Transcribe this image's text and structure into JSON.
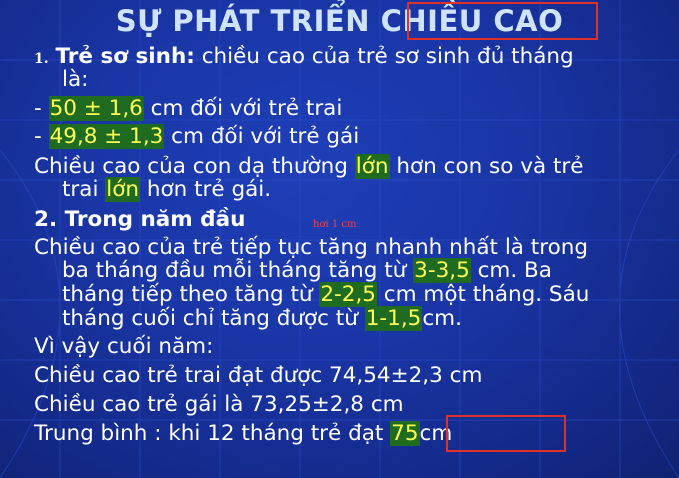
{
  "title": "SỰ PHÁT TRIỂN CHIỀU CAO",
  "section1": {
    "number": "1.",
    "heading": "Trẻ sơ sinh:",
    "text_a": " chiều cao của trẻ sơ sinh đủ tháng",
    "text_b": "là:"
  },
  "boy": {
    "dash": "- ",
    "value": "50 ± 1,6",
    "text": " cm đối với trẻ trai"
  },
  "girl": {
    "dash": "- ",
    "value": "49,8 ± 1,3",
    "text": " cm đối với trẻ gái"
  },
  "compare": {
    "l1_pre": "Chiều cao của con dạ thường ",
    "l1_hl": "lớn",
    "l1_post": " hơn con so và trẻ",
    "l2_pre": "trai ",
    "l2_hl": "lớn",
    "l2_post": " hơn trẻ gái."
  },
  "section2": {
    "heading": "2. Trong năm đầu",
    "note": "hơi 1 cm"
  },
  "growth": {
    "l1": "Chiều cao của trẻ tiếp tục tăng nhanh nhất là trong",
    "l2_pre": "ba tháng đầu mỗi tháng tăng từ ",
    "l2_hl": "3-3,5",
    "l2_post": " cm. Ba",
    "l3_pre": "tháng tiếp theo tăng từ ",
    "l3_hl": "2-2,5",
    "l3_post": " cm một tháng. Sáu",
    "l4_pre": "tháng cuối chỉ tăng được từ ",
    "l4_hl": "1-1,5",
    "l4_post": "cm."
  },
  "end_year": {
    "intro": "Vì vậy cuối năm:",
    "boy": "Chiều cao trẻ trai đạt được 74,54±2,3 cm",
    "girl": "Chiều cao trẻ gái là 73,25±2,8 cm",
    "avg_pre": "Trung bình : khi  12 tháng trẻ đạt ",
    "avg_hl": "75",
    "avg_post": "cm"
  },
  "colors": {
    "background": "#1a36a6",
    "title": "#cfe3ff",
    "highlight_bg": "#1f6b1f",
    "highlight_text": "#ffff55",
    "box": "#e0302a"
  }
}
